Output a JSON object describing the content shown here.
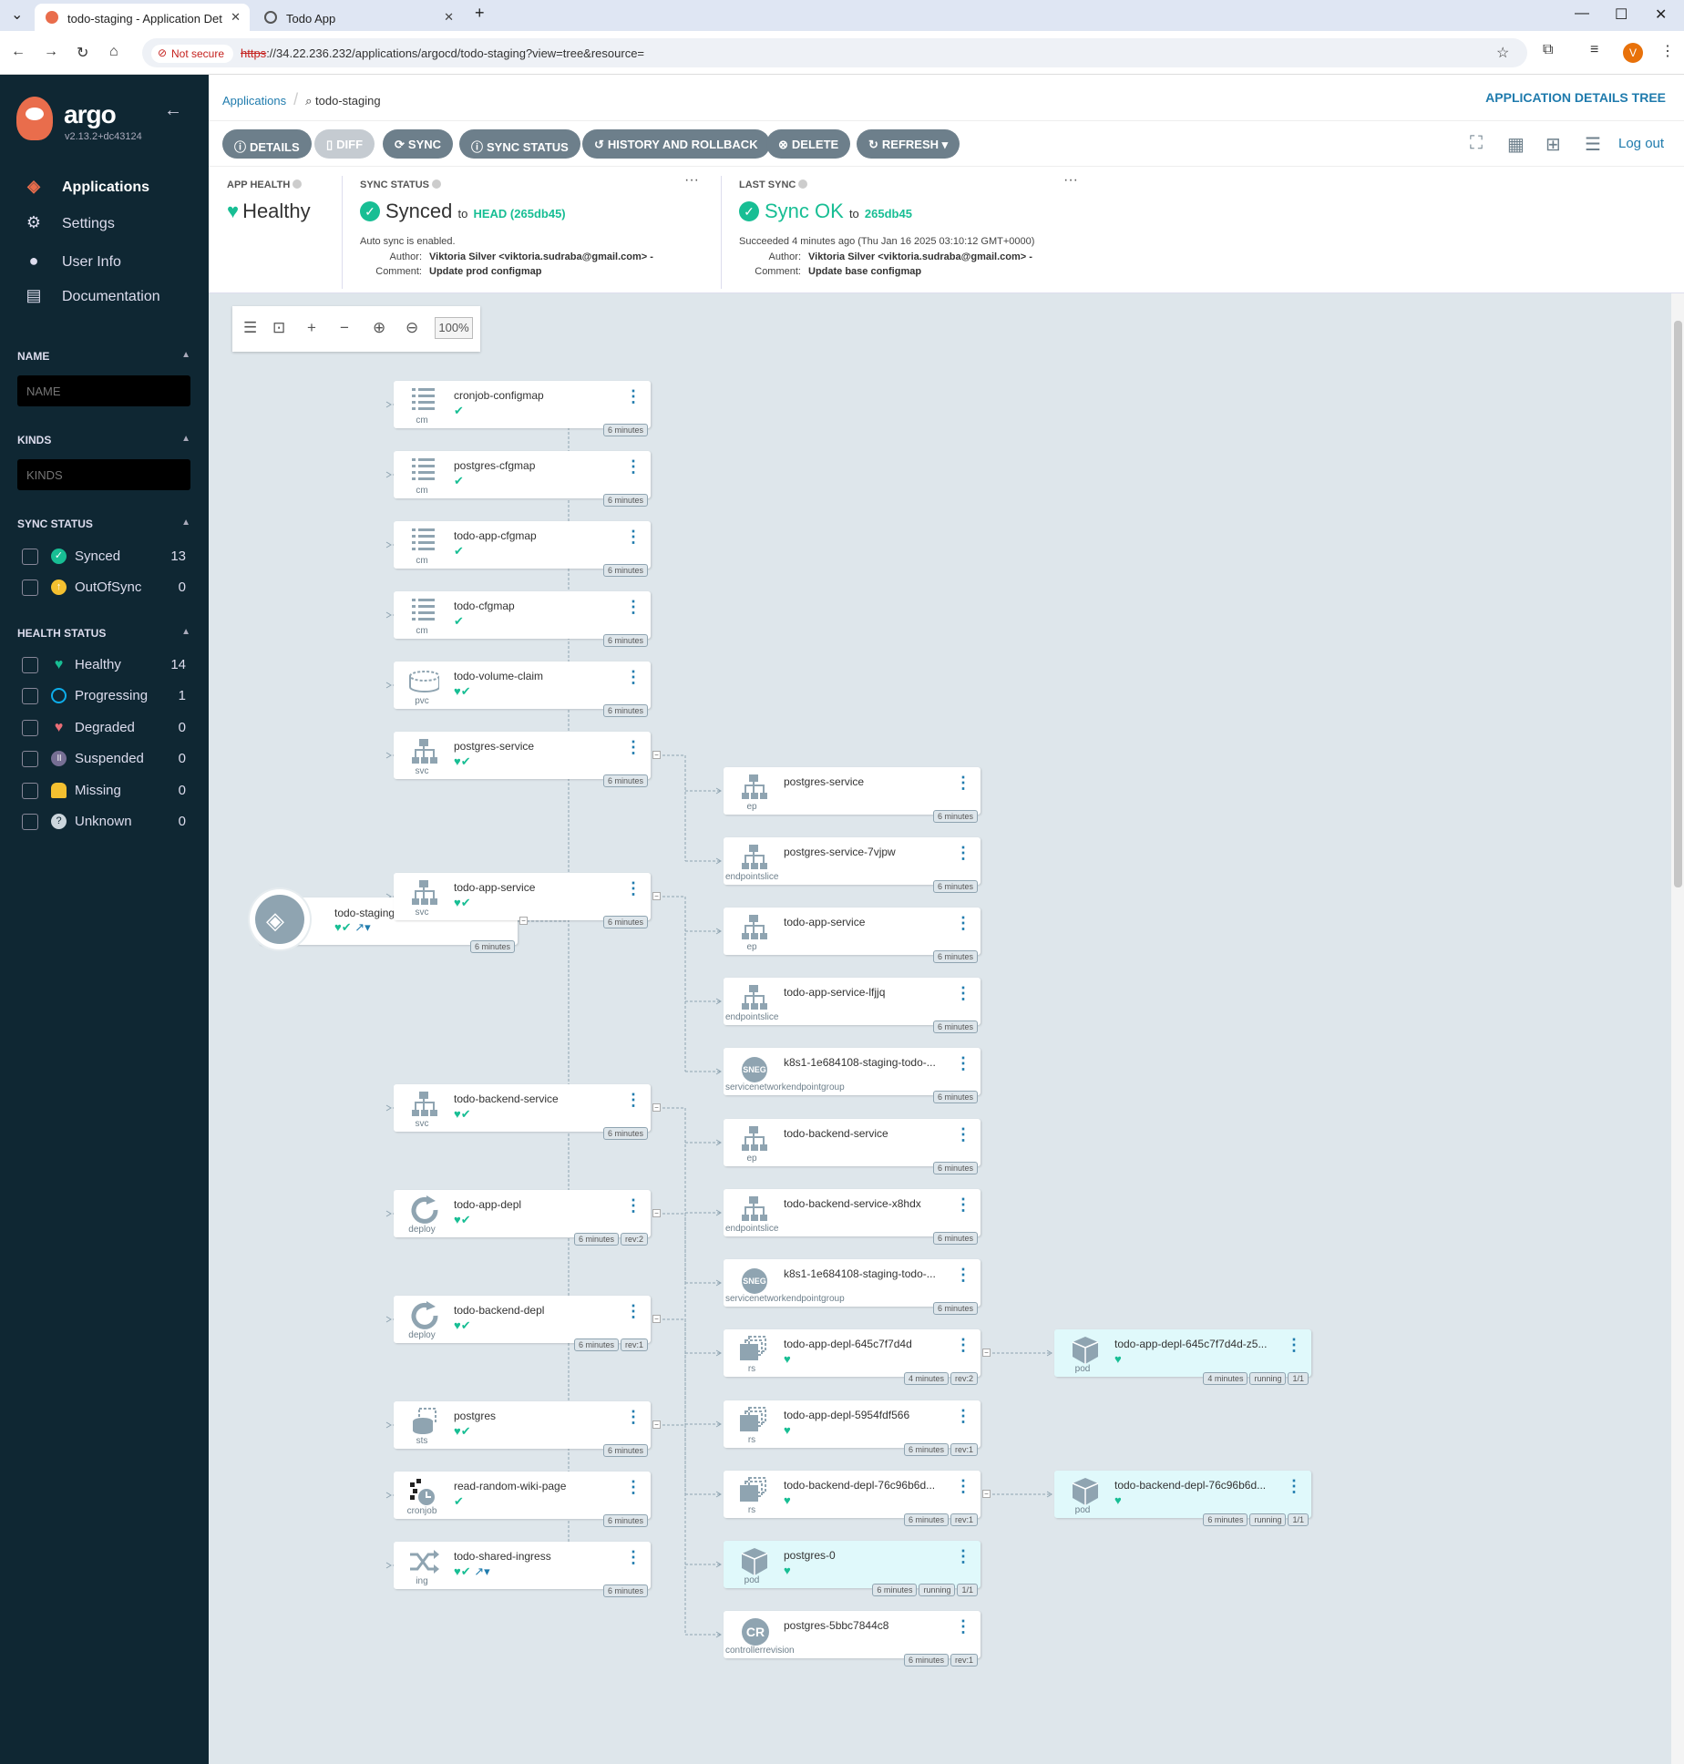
{
  "browser": {
    "tabs": [
      {
        "title": "todo-staging - Application Det"
      },
      {
        "title": "Todo App"
      }
    ],
    "not_secure": "Not secure",
    "url_scheme": "https",
    "url_rest": "://34.22.236.232/applications/argocd/todo-staging?view=tree&resource=",
    "profile_initial": "V"
  },
  "sidebar": {
    "brand": "argo",
    "version": "v2.13.2+dc43124",
    "nav": [
      {
        "label": "Applications",
        "icon": "stack-icon"
      },
      {
        "label": "Settings",
        "icon": "gear-icon"
      },
      {
        "label": "User Info",
        "icon": "user-icon"
      },
      {
        "label": "Documentation",
        "icon": "book-icon"
      }
    ],
    "name_label": "NAME",
    "name_placeholder": "NAME",
    "kinds_label": "KINDS",
    "kinds_placeholder": "KINDS",
    "sync_status_label": "SYNC STATUS",
    "sync_status": [
      {
        "label": "Synced",
        "count": "13",
        "color": "#18be94"
      },
      {
        "label": "OutOfSync",
        "count": "0",
        "color": "#f4c030"
      }
    ],
    "health_status_label": "HEALTH STATUS",
    "health_status": [
      {
        "label": "Healthy",
        "count": "14",
        "color": "#18be94"
      },
      {
        "label": "Progressing",
        "count": "1",
        "color": "#0dadea"
      },
      {
        "label": "Degraded",
        "count": "0",
        "color": "#e96d76"
      },
      {
        "label": "Suspended",
        "count": "0",
        "color": "#766f94"
      },
      {
        "label": "Missing",
        "count": "0",
        "color": "#f4c030"
      },
      {
        "label": "Unknown",
        "count": "0",
        "color": "#ccd6dd"
      }
    ]
  },
  "header": {
    "breadcrumb_root": "Applications",
    "breadcrumb_current": "todo-staging",
    "page_title": "APPLICATION DETAILS TREE",
    "logout": "Log out"
  },
  "toolbar": {
    "details": "DETAILS",
    "diff": "DIFF",
    "sync": "SYNC",
    "sync_status": "SYNC STATUS",
    "history": "HISTORY AND ROLLBACK",
    "delete": "DELETE",
    "refresh": "REFRESH"
  },
  "status": {
    "app_health_label": "APP HEALTH",
    "app_health": "Healthy",
    "sync_status_label": "SYNC STATUS",
    "sync_status": "Synced",
    "sync_to": "to",
    "sync_rev": "HEAD (265db45)",
    "auto_sync": "Auto sync is enabled.",
    "author_label": "Author:",
    "comment_label": "Comment:",
    "sync_author": "Viktoria Silver <viktoria.sudraba@gmail.com> -",
    "sync_comment": "Update prod configmap",
    "last_sync_label": "LAST SYNC",
    "last_sync": "Sync OK",
    "last_sync_to": "to",
    "last_sync_rev": "265db45",
    "last_sync_time": "Succeeded 4 minutes ago (Thu Jan 16 2025 03:10:12 GMT+0000)",
    "last_author": "Viktoria Silver <viktoria.sudraba@gmail.com> -",
    "last_comment": "Update base configmap"
  },
  "zoom": {
    "level": "100%"
  },
  "app_node": {
    "name": "todo-staging",
    "age": "6 minutes"
  },
  "nodes": [
    {
      "name": "cronjob-configmap",
      "kind": "cm",
      "tags": [
        "6 minutes"
      ]
    },
    {
      "name": "postgres-cfgmap",
      "kind": "cm",
      "tags": [
        "6 minutes"
      ]
    },
    {
      "name": "todo-app-cfgmap",
      "kind": "cm",
      "tags": [
        "6 minutes"
      ]
    },
    {
      "name": "todo-cfgmap",
      "kind": "cm",
      "tags": [
        "6 minutes"
      ]
    },
    {
      "name": "todo-volume-claim",
      "kind": "pvc",
      "tags": [
        "6 minutes"
      ]
    },
    {
      "name": "postgres-service",
      "kind": "svc",
      "tags": [
        "6 minutes"
      ]
    },
    {
      "name": "todo-app-service",
      "kind": "svc",
      "tags": [
        "6 minutes"
      ]
    },
    {
      "name": "todo-backend-service",
      "kind": "svc",
      "tags": [
        "6 minutes"
      ]
    },
    {
      "name": "todo-app-depl",
      "kind": "deploy",
      "tags": [
        "6 minutes",
        "rev:2"
      ]
    },
    {
      "name": "todo-backend-depl",
      "kind": "deploy",
      "tags": [
        "6 minutes",
        "rev:1"
      ]
    },
    {
      "name": "postgres",
      "kind": "sts",
      "tags": [
        "6 minutes"
      ]
    },
    {
      "name": "read-random-wiki-page",
      "kind": "cronjob",
      "tags": [
        "6 minutes"
      ]
    },
    {
      "name": "todo-shared-ingress",
      "kind": "ing",
      "tags": [
        "6 minutes"
      ]
    },
    {
      "name": "postgres-service",
      "kind": "ep",
      "tags": [
        "6 minutes"
      ]
    },
    {
      "name": "postgres-service-7vjpw",
      "kind": "endpointslice",
      "tags": [
        "6 minutes"
      ]
    },
    {
      "name": "todo-app-service",
      "kind": "ep",
      "tags": [
        "6 minutes"
      ]
    },
    {
      "name": "todo-app-service-lfjjq",
      "kind": "endpointslice",
      "tags": [
        "6 minutes"
      ]
    },
    {
      "name": "k8s1-1e684108-staging-todo-...",
      "kind": "servicenetworkendpointgroup",
      "tags": [
        "6 minutes"
      ]
    },
    {
      "name": "todo-backend-service",
      "kind": "ep",
      "tags": [
        "6 minutes"
      ]
    },
    {
      "name": "todo-backend-service-x8hdx",
      "kind": "endpointslice",
      "tags": [
        "6 minutes"
      ]
    },
    {
      "name": "k8s1-1e684108-staging-todo-...",
      "kind": "servicenetworkendpointgroup",
      "tags": [
        "6 minutes"
      ]
    },
    {
      "name": "todo-app-depl-645c7f7d4d",
      "kind": "rs",
      "tags": [
        "4 minutes",
        "rev:2"
      ]
    },
    {
      "name": "todo-app-depl-5954fdf566",
      "kind": "rs",
      "tags": [
        "6 minutes",
        "rev:1"
      ]
    },
    {
      "name": "todo-backend-depl-76c96b6d...",
      "kind": "rs",
      "tags": [
        "6 minutes",
        "rev:1"
      ]
    },
    {
      "name": "postgres-0",
      "kind": "pod",
      "tags": [
        "6 minutes",
        "running",
        "1/1"
      ]
    },
    {
      "name": "postgres-5bbc7844c8",
      "kind": "controllerrevision",
      "tags": [
        "6 minutes",
        "rev:1"
      ]
    },
    {
      "name": "todo-app-depl-645c7f7d4d-z5...",
      "kind": "pod",
      "tags": [
        "4 minutes",
        "running",
        "1/1"
      ]
    },
    {
      "name": "todo-backend-depl-76c96b6d...",
      "kind": "pod",
      "tags": [
        "6 minutes",
        "running",
        "1/1"
      ]
    }
  ]
}
